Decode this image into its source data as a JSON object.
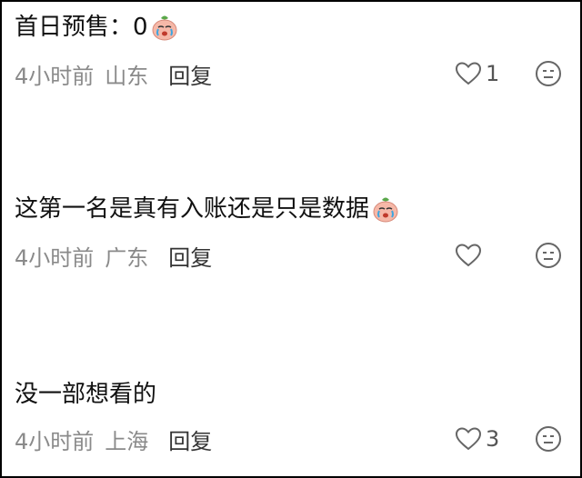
{
  "comments": [
    {
      "text": "首日预售：0",
      "sticker_icon": "crying-face-sticker",
      "time": "4小时前",
      "location": "山东",
      "reply_label": "回复",
      "like_count": "1"
    },
    {
      "text": "这第一名是真有入账还是只是数据",
      "sticker_icon": "crying-face-sticker",
      "time": "4小时前",
      "location": "广东",
      "reply_label": "回复",
      "like_count": ""
    },
    {
      "text": "没一部想看的",
      "sticker_icon": "",
      "time": "4小时前",
      "location": "上海",
      "reply_label": "回复",
      "like_count": "3"
    }
  ],
  "icons": {
    "like": "heart-outline-icon",
    "emoji": "smiley-face-icon"
  },
  "colors": {
    "text": "#111111",
    "meta": "#8a8a8a",
    "icon": "#666666",
    "sticker_face": "#f6b8a8",
    "sticker_leaf": "#5aa84a"
  }
}
